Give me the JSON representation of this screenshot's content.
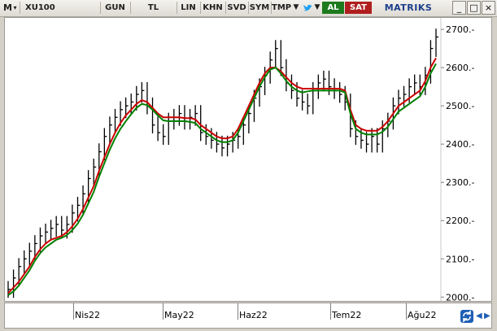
{
  "toolbar": {
    "menu_label": "M",
    "symbol": "XU100",
    "period": "GUN",
    "currency": "TL",
    "scale": "LIN",
    "btn_khn": "KHN",
    "btn_svd": "SVD",
    "btn_sym": "SYM",
    "btn_tmp": "TMP",
    "buy_label": "AL",
    "sell_label": "SAT",
    "brand": "MATRIKS",
    "colors": {
      "buy": "#1e7a1e",
      "sell": "#b01e1e",
      "brand": "#1c3f8c"
    }
  },
  "window": {
    "minimize": "_",
    "maximize": "□",
    "close": "×"
  },
  "chart_data": {
    "type": "line",
    "title": "",
    "xlabel": "",
    "ylabel": "",
    "ylim": [
      1990,
      2730
    ],
    "yticks": [
      2000,
      2100,
      2200,
      2300,
      2400,
      2500,
      2600,
      2700
    ],
    "ytick_labels": [
      "2000.-",
      "2100.-",
      "2200.-",
      "2300.-",
      "2400.-",
      "2500.-",
      "2600.-",
      "2700.-"
    ],
    "xtick_labels": [
      "Nis22",
      "May22",
      "Haz22",
      "Tem22",
      "Ağu22"
    ],
    "grid": false,
    "series": [
      {
        "color": "#000000",
        "values": [
          2020,
          2050,
          2080,
          2100,
          2120,
          2140,
          2160,
          2170,
          2180,
          2190,
          2175,
          2190,
          2220,
          2240,
          2270,
          2310,
          2340,
          2380,
          2420,
          2450,
          2470,
          2490,
          2500,
          2510,
          2530,
          2540,
          2500,
          2450,
          2430,
          2420,
          2460,
          2470,
          2480,
          2460,
          2470,
          2480,
          2430,
          2420,
          2410,
          2400,
          2390,
          2400,
          2410,
          2420,
          2450,
          2480,
          2520,
          2550,
          2580,
          2620,
          2650,
          2600,
          2560,
          2540,
          2520,
          2510,
          2500,
          2540,
          2560,
          2570,
          2550,
          2540,
          2530,
          2510,
          2440,
          2420,
          2410,
          2400,
          2420,
          2400,
          2440,
          2460,
          2500,
          2520,
          2530,
          2550,
          2560,
          2550,
          2580,
          2650,
          2680
        ]
      },
      {
        "color": "#cc0000",
        "values": [
          2010,
          2025,
          2040,
          2060,
          2080,
          2105,
          2125,
          2140,
          2150,
          2155,
          2160,
          2170,
          2185,
          2205,
          2230,
          2260,
          2290,
          2330,
          2365,
          2400,
          2430,
          2455,
          2475,
          2490,
          2505,
          2515,
          2510,
          2495,
          2480,
          2470,
          2470,
          2470,
          2470,
          2468,
          2468,
          2465,
          2450,
          2440,
          2430,
          2420,
          2415,
          2415,
          2420,
          2440,
          2470,
          2500,
          2530,
          2560,
          2585,
          2600,
          2600,
          2590,
          2575,
          2560,
          2550,
          2545,
          2545,
          2545,
          2545,
          2545,
          2545,
          2545,
          2545,
          2540,
          2490,
          2450,
          2440,
          2435,
          2435,
          2435,
          2445,
          2460,
          2480,
          2500,
          2510,
          2520,
          2530,
          2540,
          2565,
          2600,
          2625
        ]
      },
      {
        "color": "#008000",
        "values": [
          2005,
          2015,
          2030,
          2050,
          2070,
          2095,
          2115,
          2130,
          2140,
          2150,
          2155,
          2162,
          2175,
          2192,
          2215,
          2245,
          2275,
          2315,
          2350,
          2385,
          2415,
          2440,
          2460,
          2478,
          2495,
          2505,
          2502,
          2490,
          2475,
          2462,
          2460,
          2460,
          2460,
          2460,
          2458,
          2455,
          2440,
          2430,
          2420,
          2410,
          2405,
          2405,
          2410,
          2430,
          2460,
          2490,
          2520,
          2550,
          2575,
          2595,
          2600,
          2585,
          2565,
          2550,
          2540,
          2535,
          2538,
          2540,
          2540,
          2540,
          2540,
          2540,
          2540,
          2535,
          2480,
          2440,
          2430,
          2425,
          2425,
          2425,
          2432,
          2445,
          2465,
          2485,
          2495,
          2505,
          2515,
          2525,
          2550,
          2585,
          2610
        ]
      }
    ]
  }
}
